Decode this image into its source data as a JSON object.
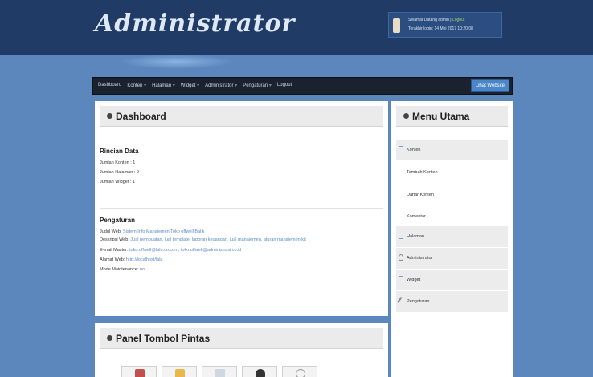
{
  "header": {
    "logo": "Administrator",
    "user_line": "Selamat Datang admin",
    "logout_link": "Logout",
    "last_login": "Terakhir login: 14 Mei 2017 10:20:08"
  },
  "nav": {
    "items": [
      "Dashboard",
      "Konten",
      "Halaman",
      "Widget",
      "Administrator",
      "Pengaturan",
      "Logout"
    ],
    "view_site": "Lihat Website"
  },
  "dashboard": {
    "title": "Dashboard",
    "rincian_title": "Rincian Data",
    "rincian": [
      {
        "label": "Jumlah Konten",
        "value": ": 1"
      },
      {
        "label": "Jumlah Halaman",
        "value": ": 0"
      },
      {
        "label": "Jumlah Widget",
        "value": ": 1"
      }
    ],
    "pengaturan_title": "Pengaturan",
    "pengaturan": [
      {
        "label": "Judul Web:",
        "value": "Sistem Info Manajemen Toko offwell Batik"
      },
      {
        "label": "Deskripsi Web:",
        "value": "Jual pembuatan, jual template, laporan keuangan, jual manajemen, aturan manajemen kit"
      },
      {
        "label": "E-mail Master:",
        "value": "toko.offwell@lalu.co.com, toko.offwell@administrasi.co.id"
      },
      {
        "label": "Alamat Web:",
        "value": "http://localhost/lala"
      },
      {
        "label": "Mode Maintenance:",
        "value": "no"
      }
    ]
  },
  "menu_utama": {
    "title": "Menu Utama",
    "items": [
      {
        "label": "Konten",
        "shaded": true
      },
      {
        "label": "Tambah Konten",
        "shaded": false
      },
      {
        "label": "Daftar Konten",
        "shaded": false
      },
      {
        "label": "Komentar",
        "shaded": false
      },
      {
        "label": "Halaman",
        "shaded": true
      },
      {
        "label": "Administrator",
        "shaded": true
      },
      {
        "label": "Widget",
        "shaded": true
      },
      {
        "label": "Pengaturan",
        "shaded": true
      }
    ]
  },
  "panel_pintas": {
    "title": "Panel Tombol Pintas"
  },
  "colors": {
    "background": "#5b87bd",
    "header": "#1f3b66",
    "navbar": "#1a2230",
    "accent": "#4a86c8"
  }
}
